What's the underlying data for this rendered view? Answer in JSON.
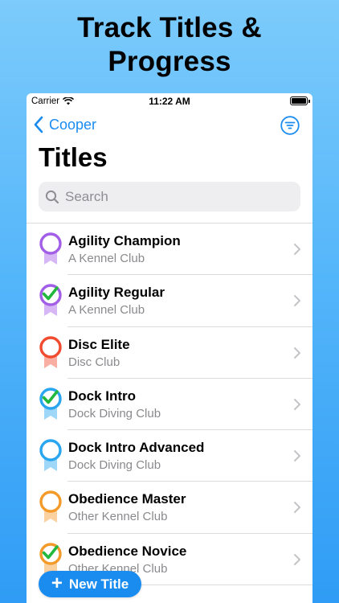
{
  "headline": [
    "Track Titles &",
    "Progress"
  ],
  "status_bar": {
    "carrier": "Carrier",
    "time": "11:22 AM"
  },
  "nav": {
    "back_label": "Cooper"
  },
  "page_title": "Titles",
  "search": {
    "placeholder": "Search"
  },
  "colors": {
    "accent": "#1a8cf0",
    "purple": "#a35ee8",
    "red": "#f04b2f",
    "blue": "#2aa6f0",
    "orange": "#f39a2a",
    "check": "#22b83d"
  },
  "titles": [
    {
      "title": "Agility Champion",
      "club": "A Kennel Club",
      "color": "purple",
      "earned": false
    },
    {
      "title": "Agility Regular",
      "club": "A Kennel Club",
      "color": "purple",
      "earned": true
    },
    {
      "title": "Disc Elite",
      "club": "Disc Club",
      "color": "red",
      "earned": false
    },
    {
      "title": "Dock Intro",
      "club": "Dock Diving Club",
      "color": "blue",
      "earned": true
    },
    {
      "title": "Dock Intro Advanced",
      "club": "Dock Diving Club",
      "color": "blue",
      "earned": false
    },
    {
      "title": "Obedience Master",
      "club": "Other Kennel Club",
      "color": "orange",
      "earned": false
    },
    {
      "title": "Obedience Novice",
      "club": "Other Kennel Club",
      "color": "orange",
      "earned": true
    }
  ],
  "fab": {
    "label": "New Title"
  }
}
